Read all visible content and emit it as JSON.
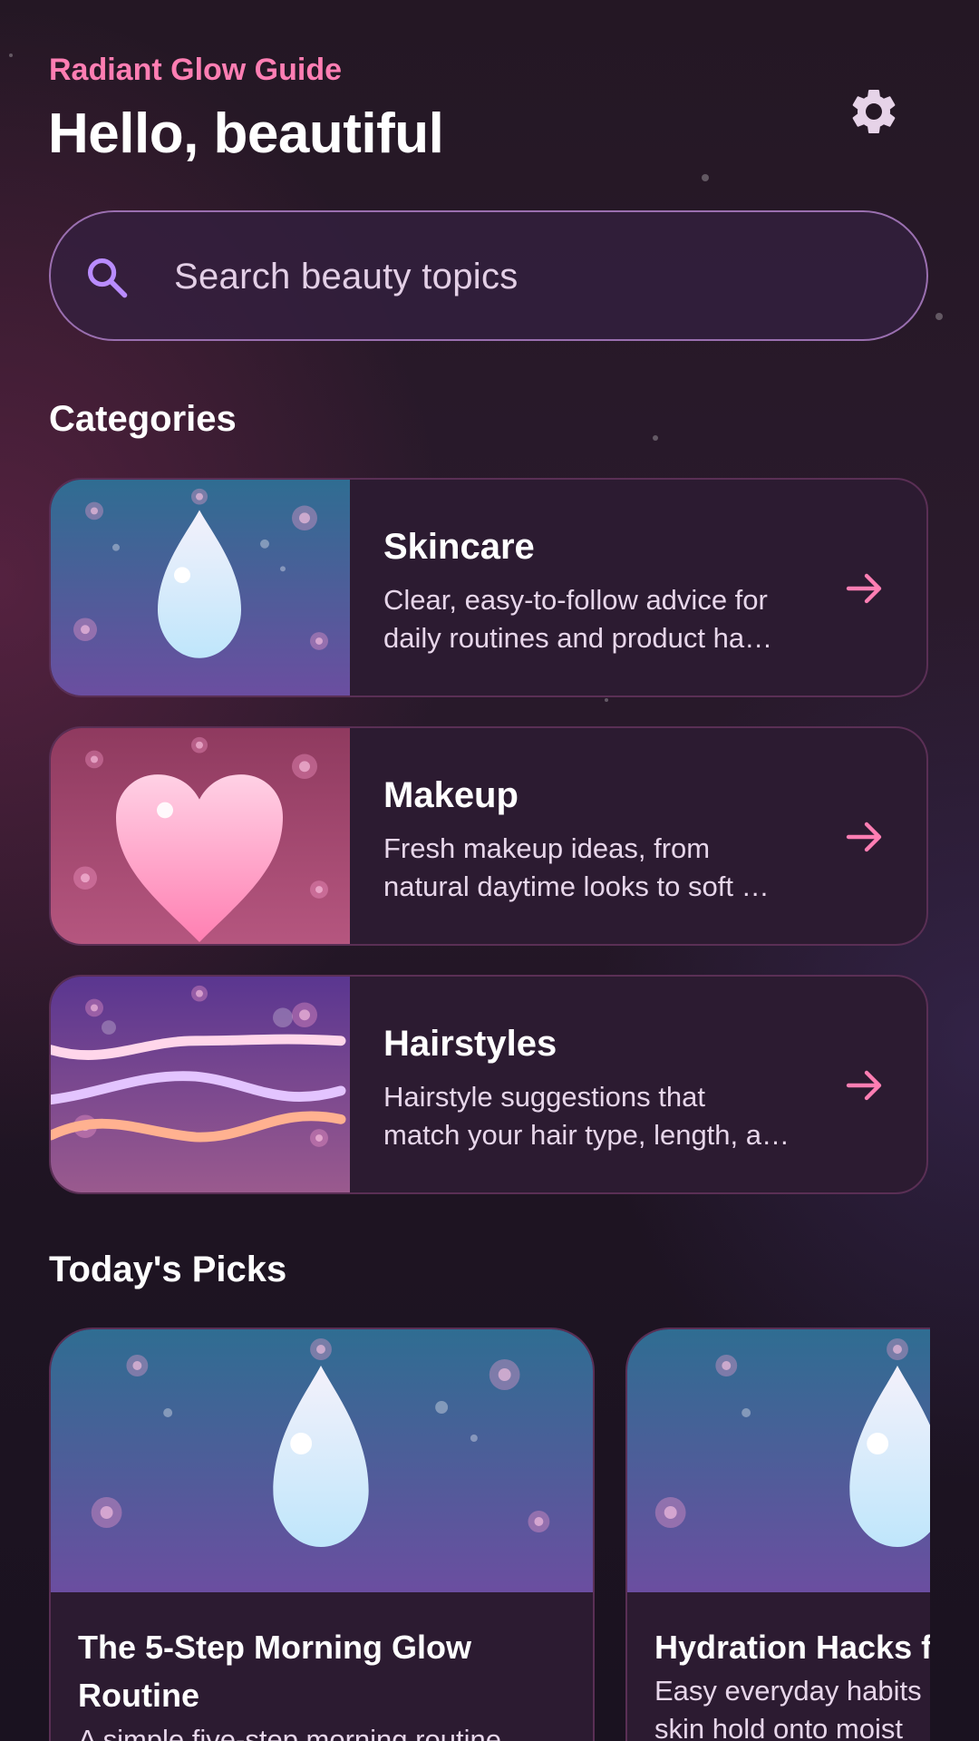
{
  "header": {
    "app_name": "Radiant Glow Guide",
    "greeting": "Hello, beautiful",
    "settings_icon": "gear-icon"
  },
  "search": {
    "placeholder": "Search beauty topics",
    "icon": "search-icon"
  },
  "categories": {
    "title": "Categories",
    "items": [
      {
        "label": "Skincare",
        "desc_line1": "Clear, easy-to-follow advice for",
        "desc_line2": "daily routines and product ha…",
        "icon": "water-drop-icon"
      },
      {
        "label": "Makeup",
        "desc_line1": "Fresh makeup ideas, from",
        "desc_line2": "natural daytime looks to soft …",
        "icon": "heart-icon"
      },
      {
        "label": "Hairstyles",
        "desc_line1": "Hairstyle suggestions that",
        "desc_line2": "match your hair type, length, a…",
        "icon": "hair-waves-icon"
      }
    ]
  },
  "picks": {
    "title": "Today's Picks",
    "items": [
      {
        "title_line1": "The 5-Step Morning Glow",
        "title_line2": "Routine",
        "desc": "A simple five-step morning routine"
      },
      {
        "title_line1": "Hydration Hacks fo",
        "desc_line1": "Easy everyday habits",
        "desc_line2": "skin hold onto moist"
      }
    ]
  },
  "colors": {
    "accent_pink": "#ff7eb3",
    "accent_purple": "#b98cff",
    "card_bg": "#2c1b31"
  }
}
